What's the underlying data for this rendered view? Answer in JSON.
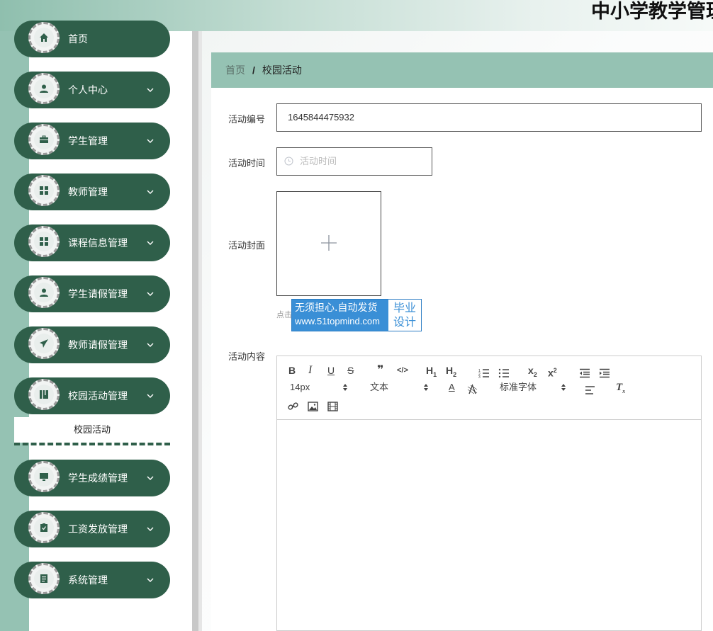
{
  "header": {
    "title": "中小学教学管理"
  },
  "sidebar": {
    "items": [
      {
        "label": "首页",
        "icon": "home-icon"
      },
      {
        "label": "个人中心",
        "icon": "user-icon"
      },
      {
        "label": "学生管理",
        "icon": "briefcase-icon"
      },
      {
        "label": "教师管理",
        "icon": "grid-icon"
      },
      {
        "label": "课程信息管理",
        "icon": "grid-icon"
      },
      {
        "label": "学生请假管理",
        "icon": "user-icon"
      },
      {
        "label": "教师请假管理",
        "icon": "send-icon"
      },
      {
        "label": "校园活动管理",
        "icon": "book-icon"
      },
      {
        "label": "学生成绩管理",
        "icon": "monitor-icon"
      },
      {
        "label": "工资发放管理",
        "icon": "clipboard-check-icon"
      },
      {
        "label": "系统管理",
        "icon": "document-icon"
      }
    ],
    "submenu": {
      "label": "校园活动"
    }
  },
  "breadcrumb": {
    "home": "首页",
    "separator": "/",
    "current": "校园活动"
  },
  "form": {
    "id_label": "活动编号",
    "id_value": "1645844475932",
    "time_label": "活动时间",
    "time_placeholder": "活动时间",
    "cover_label": "活动封面",
    "upload_tip": "点击上传活动封面",
    "content_label": "活动内容"
  },
  "watermark": {
    "line1": "无须担心.自动发货",
    "line2": "www.51topmind.com",
    "badge1": "毕业",
    "badge2": "设计"
  },
  "editor": {
    "font_size": "14px",
    "header_select": "文本",
    "font_family": "标准字体"
  },
  "colors": {
    "sidebar_item": "#2f5f4a",
    "accent": "#95c2b3",
    "watermark": "#3a8fd6"
  }
}
